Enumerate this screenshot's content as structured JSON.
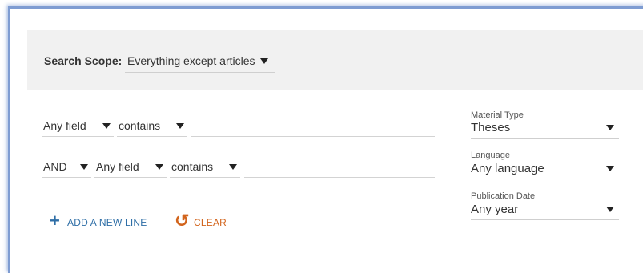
{
  "scope": {
    "label": "Search Scope:",
    "value": "Everything except articles"
  },
  "query_rows": [
    {
      "field": "Any field",
      "operator": "contains",
      "value": ""
    },
    {
      "boolean": "AND",
      "field": "Any field",
      "operator": "contains",
      "value": ""
    }
  ],
  "facets": {
    "material_type": {
      "label": "Material Type",
      "value": "Theses"
    },
    "language": {
      "label": "Language",
      "value": "Any language"
    },
    "publication_date": {
      "label": "Publication Date",
      "value": "Any year"
    }
  },
  "actions": {
    "add_line": "ADD A NEW LINE",
    "clear": "CLEAR"
  },
  "icons": {
    "add": "plus-icon",
    "clear": "undo-arrow-icon",
    "dropdown": "caret-down-icon"
  },
  "colors": {
    "add_action": "#2e6ea6",
    "clear_action": "#d2641c",
    "panel_border": "#7e9cd2"
  }
}
